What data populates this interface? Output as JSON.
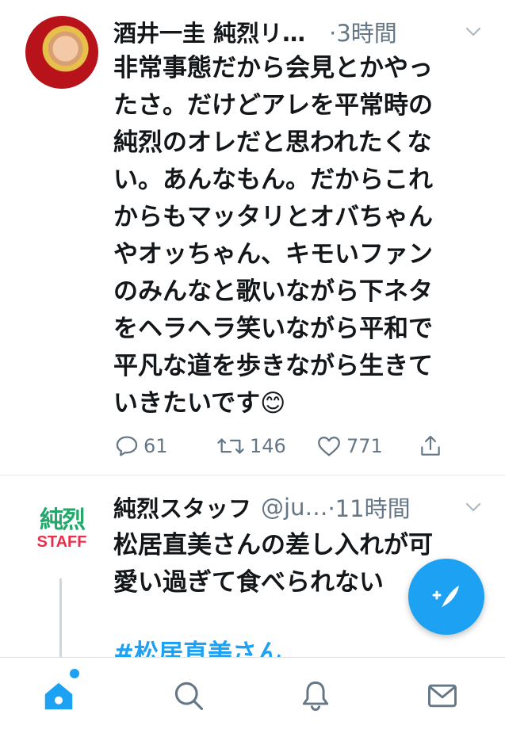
{
  "tweets": [
    {
      "author_name": "酒井一圭 純烈リ…",
      "timestamp": "·3時間",
      "body_lines": [
        "非常事態だから会見とかやっ",
        "たさ。だけどアレを平常時の",
        "純烈のオレだと思われたくな",
        "い。あんなもん。だからこれ",
        "からもマッタリとオバちゃん",
        "やオッちゃん、キモいファン",
        "のみんなと歌いながら下ネタ",
        "をヘラヘラ笑いながら平和で",
        "平凡な道を歩きながら生きて",
        "いきたいです😊"
      ],
      "reply_count": "61",
      "retweet_count": "146",
      "like_count": "771"
    },
    {
      "author_name": "純烈スタッフ",
      "handle": "@ju…",
      "timestamp": "·11時間",
      "avatar_logo_kanji": "純烈",
      "avatar_logo_text": "STAFF",
      "body_lines": [
        "松居直美さんの差し入れが可",
        "愛い過ぎて食べられない"
      ],
      "hashtag": "#松居直美さん"
    }
  ],
  "icons": {
    "reply": "reply-icon",
    "retweet": "retweet-icon",
    "like": "like-icon",
    "share": "share-icon",
    "chevron": "chevron-down-icon",
    "compose": "compose-tweet-icon"
  },
  "tabbar": [
    "home-icon",
    "search-icon",
    "notifications-icon",
    "messages-icon"
  ],
  "colors": {
    "accent": "#1da1f2",
    "text": "#14171a",
    "muted": "#657786"
  }
}
